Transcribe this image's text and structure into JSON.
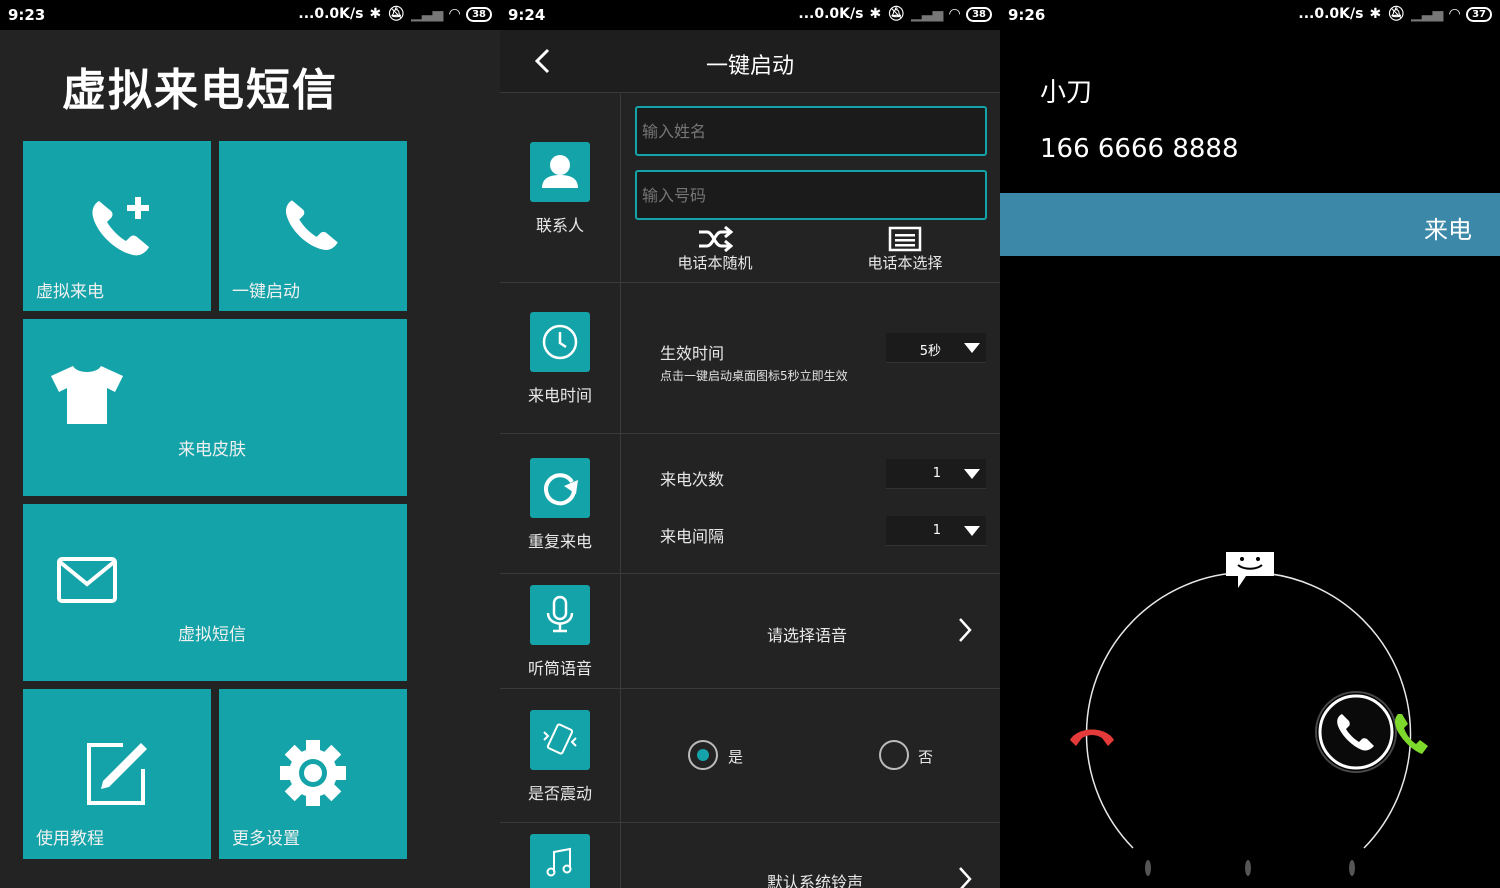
{
  "status_bars": [
    {
      "time": "9:23",
      "speed": "...0.0K/s",
      "battery": "38"
    },
    {
      "time": "9:24",
      "speed": "...0.0K/s",
      "battery": "38"
    },
    {
      "time": "9:26",
      "speed": "...0.0K/s",
      "battery": "37"
    }
  ],
  "home": {
    "title": "虚拟来电短信",
    "tiles": {
      "fake_call": "虚拟来电",
      "one_key_start": "一键启动",
      "call_skin": "来电皮肤",
      "fake_sms": "虚拟短信",
      "tutorial": "使用教程",
      "more_settings": "更多设置"
    },
    "accent": "#14a3a8"
  },
  "one_key": {
    "title": "一键启动",
    "contact": {
      "label": "联系人",
      "name_placeholder": "输入姓名",
      "number_placeholder": "输入号码",
      "random_label": "电话本随机",
      "select_label": "电话本选择"
    },
    "call_time": {
      "label": "来电时间",
      "effective_label": "生效时间",
      "effective_value": "5秒",
      "hint": "点击一键启动桌面图标5秒立即生效"
    },
    "repeat": {
      "label": "重复来电",
      "count_label": "来电次数",
      "count_value": "1",
      "interval_label": "来电间隔",
      "interval_value": "1"
    },
    "voice": {
      "label": "听筒语音",
      "select_text": "请选择语音"
    },
    "vibrate": {
      "label": "是否震动",
      "yes": "是",
      "no": "否",
      "selected": "是"
    },
    "ringtone": {
      "text": "默认系统铃声"
    }
  },
  "incoming": {
    "caller_name": "小刀",
    "caller_number": "166 6666 8888",
    "banner": "来电",
    "banner_color": "#3b88a8",
    "icons": [
      "message-icon",
      "decline-icon",
      "answer-icon"
    ]
  }
}
